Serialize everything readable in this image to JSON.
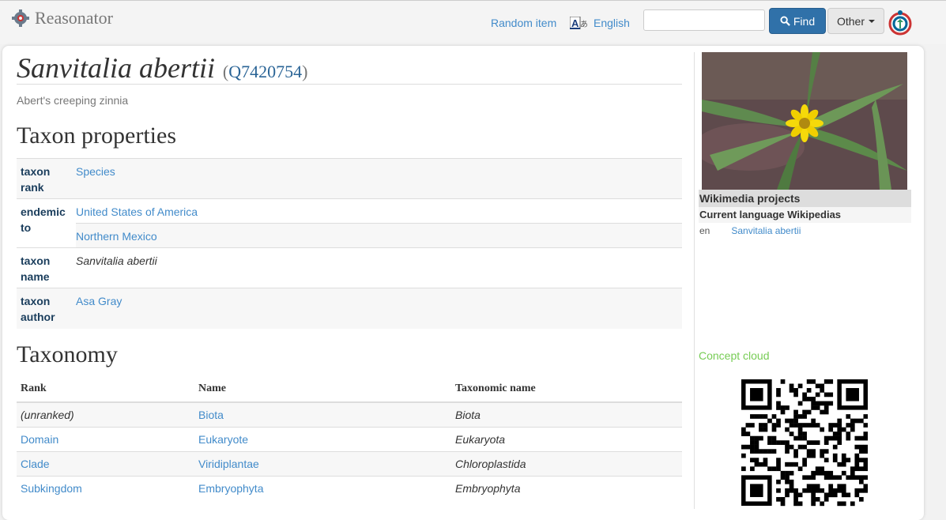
{
  "navbar": {
    "brand": "Reasonator",
    "random_item": "Random item",
    "language": "English",
    "search_value": "",
    "find_label": "Find",
    "other_label": "Other"
  },
  "item": {
    "title": "Sanvitalia abertii",
    "qid": "Q7420754",
    "description": "Abert's creeping zinnia"
  },
  "taxon_properties": {
    "heading": "Taxon properties",
    "rows": [
      {
        "key": "taxon rank",
        "values": [
          "Species"
        ]
      },
      {
        "key": "endemic to",
        "values": [
          "United States of America",
          "Northern Mexico"
        ]
      },
      {
        "key": "taxon name",
        "values": [
          "Sanvitalia abertii"
        ]
      },
      {
        "key": "taxon author",
        "values": [
          "Asa Gray"
        ]
      }
    ]
  },
  "taxonomy": {
    "heading": "Taxonomy",
    "columns": [
      "Rank",
      "Name",
      "Taxonomic name"
    ],
    "rows": [
      {
        "rank": "(unranked)",
        "name": "Biota",
        "taxonomic_name": "Biota"
      },
      {
        "rank": "Domain",
        "name": "Eukaryote",
        "taxonomic_name": "Eukaryota"
      },
      {
        "rank": "Clade",
        "name": "Viridiplantae",
        "taxonomic_name": "Chloroplastida"
      },
      {
        "rank": "Subkingdom",
        "name": "Embryophyta",
        "taxonomic_name": "Embryophyta"
      }
    ]
  },
  "sidebar": {
    "wikimedia_projects": "Wikimedia projects",
    "current_language": "Current language Wikipedias",
    "wiki_code": "en",
    "wiki_title": "Sanvitalia abertii",
    "concept_cloud": "Concept cloud"
  },
  "colors": {
    "link": "#428bca",
    "find_button": "#3071a9",
    "concept_cloud": "#77cc55"
  },
  "icons": [
    "reasonator-logo-icon",
    "translate-icon",
    "search-icon",
    "caret-down-icon",
    "wikimedia-commons-icon",
    "qr-code-icon"
  ]
}
